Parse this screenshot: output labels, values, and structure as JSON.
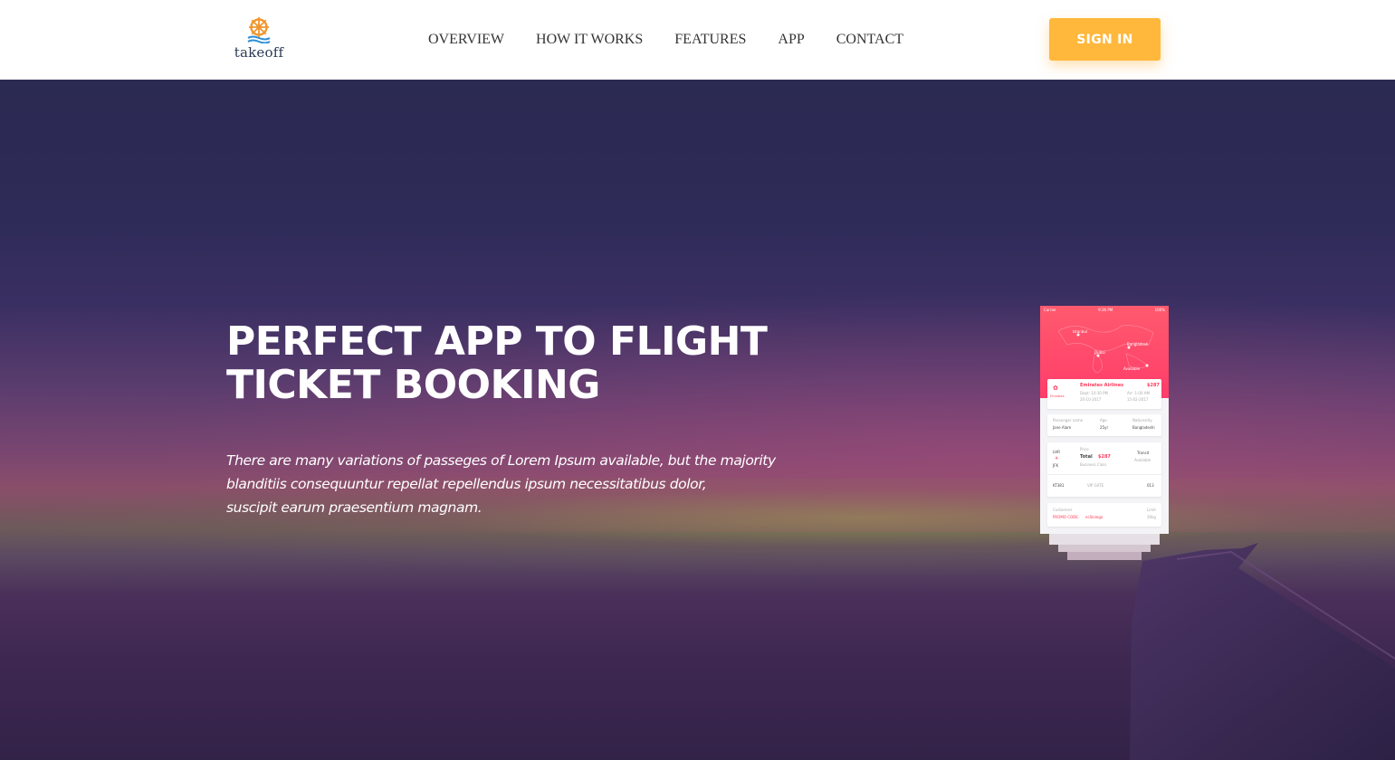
{
  "header": {
    "logo_text": "takeoff",
    "nav": [
      "OVERVIEW",
      "HOW IT WORKS",
      "FEATURES",
      "APP",
      "CONTACT"
    ],
    "signin_label": "SIGN IN",
    "accent": "#ffb83c"
  },
  "hero": {
    "headline_line1": "PERFECT APP TO FLIGHT",
    "headline_line2": "TICKET BOOKING",
    "lead_line1": "There are many variations of passeges of Lorem Ipsum available, but the majority",
    "lead_line2": "blanditiis consequuntur repellat repellendus ipsum necessitatibus dolor,",
    "lead_line3": "suscipit earum praesentium magnam."
  },
  "phone": {
    "status_left": "Carrier",
    "status_time": "9:36 PM",
    "status_right": "100%",
    "map_labels": [
      "Istanbul",
      "Bangladesh",
      "Dubai",
      "Available"
    ],
    "airline": "Emirates Airlines",
    "airline_logo": "Emirates",
    "price": "$287",
    "dept_time": "Dept: 10:30 PM",
    "dept_date": "20-10-2017",
    "arr_time": "Arr: 1:00 AM",
    "arr_date": "15-02-2017",
    "passenger_label": "Passenger name",
    "passenger": "Jane Alam",
    "age_label": "Age",
    "age": "25yr",
    "nationality_label": "Nationality",
    "nationality": "Bangladeshi",
    "from": "LHR",
    "to": "JFK",
    "price_label": "Price",
    "total_label": "Total",
    "total": "$287",
    "class": "Business Class",
    "transit_label": "Transit",
    "transit_status": "Available",
    "flight_no": "KT381",
    "gate": "VIP GATE",
    "seat": "013",
    "customers_label": "Customers",
    "promo_label": "PROMO CODE:",
    "promo_code": "ecSlolego",
    "limit_label": "Limit",
    "limit": "30kg",
    "brand_color": "#ff3b5c"
  }
}
